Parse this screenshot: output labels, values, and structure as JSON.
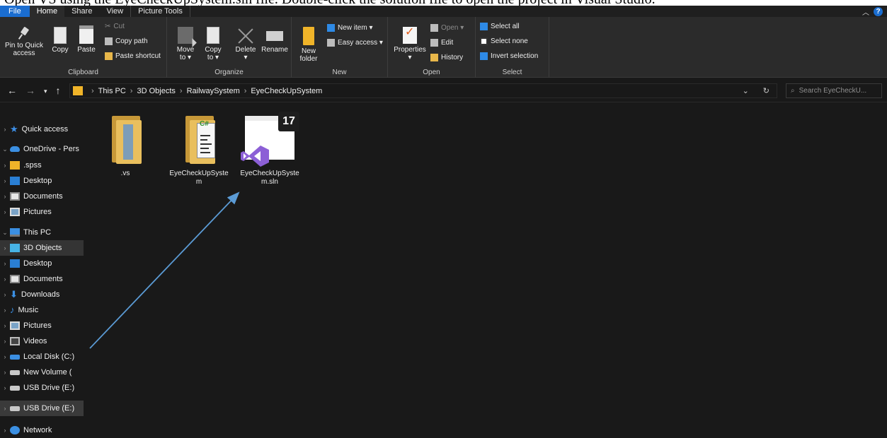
{
  "caption": "Open VS using the EyeCheckUpSystem.sln file. Double-click the solution file to open the project in Visual Studio.",
  "tabs": {
    "file": "File",
    "home": "Home",
    "share": "Share",
    "view": "View",
    "picture_tools": "Picture Tools"
  },
  "ribbon": {
    "clipboard": {
      "label": "Clipboard",
      "pin": "Pin to Quick access",
      "pin_l1": "Pin to Quick",
      "pin_l2": "access",
      "copy": "Copy",
      "paste": "Paste",
      "cut": "Cut",
      "copy_path": "Copy path",
      "paste_shortcut": "Paste shortcut"
    },
    "organize": {
      "label": "Organize",
      "move_to_l1": "Move",
      "move_to_l2": "to ▾",
      "copy_to_l1": "Copy",
      "copy_to_l2": "to ▾",
      "delete_l1": "Delete",
      "delete_l2": "▾",
      "rename": "Rename"
    },
    "new": {
      "label": "New",
      "new_folder_l1": "New",
      "new_folder_l2": "folder",
      "new_item": "New item ▾",
      "easy_access": "Easy access ▾"
    },
    "open": {
      "label": "Open",
      "properties_l1": "Properties",
      "properties_l2": "▾",
      "open": "Open ▾",
      "edit": "Edit",
      "history": "History"
    },
    "select": {
      "label": "Select",
      "select_all": "Select all",
      "select_none": "Select none",
      "invert_selection": "Invert selection"
    }
  },
  "address": {
    "crumbs": [
      "This PC",
      "3D Objects",
      "RailwaySystem",
      "EyeCheckUpSystem"
    ],
    "search_placeholder": "Search EyeCheckU..."
  },
  "nav": {
    "quick_access": "Quick access",
    "onedrive": "OneDrive - Pers",
    "od_spss": ".spss",
    "od_desktop": "Desktop",
    "od_documents": "Documents",
    "od_pictures": "Pictures",
    "this_pc": "This PC",
    "pc_3d": "3D Objects",
    "pc_desktop": "Desktop",
    "pc_documents": "Documents",
    "pc_downloads": "Downloads",
    "pc_music": "Music",
    "pc_pictures": "Pictures",
    "pc_videos": "Videos",
    "local_disk": "Local Disk (C:)",
    "new_volume": "New Volume (",
    "usb_drive": "USB Drive (E:)",
    "usb_drive_root": "USB Drive (E:)",
    "network": "Network"
  },
  "files": [
    {
      "name": ".vs",
      "type": "folder"
    },
    {
      "name": "EyeCheckUpSystem",
      "type": "csproj-folder"
    },
    {
      "name": "EyeCheckUpSystem.sln",
      "type": "solution",
      "badge": "17"
    }
  ],
  "colors": {
    "accent_blue": "#1a6dd0",
    "folder_yellow": "#f0b429",
    "vs_purple": "#8c5fd6",
    "arrow_blue": "#5b9bd5"
  }
}
